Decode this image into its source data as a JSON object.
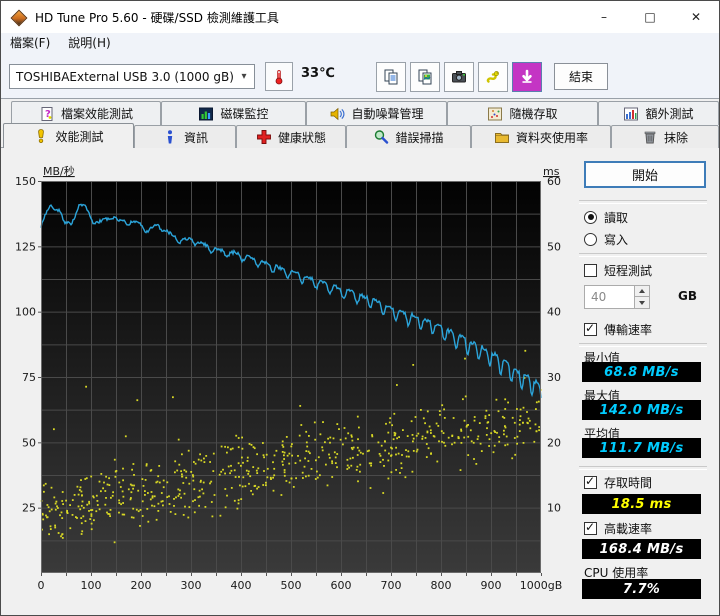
{
  "window": {
    "title": "HD Tune Pro 5.60 - 硬碟/SSD 檢測維護工具",
    "minimize": "–",
    "maximize": "□",
    "close": "✕"
  },
  "menu": {
    "file": "檔案(F)",
    "help": "說明(H)"
  },
  "toolbar": {
    "drive": "TOSHIBAExternal USB 3.0 (1000 gB)",
    "temperature": "33℃",
    "exit": "結束",
    "icons": [
      "thermometer-icon",
      "copy-text-icon",
      "copy-image-icon",
      "camera-icon",
      "gecko-icon",
      "download-icon"
    ]
  },
  "tabs": {
    "back": [
      {
        "label": "檔案效能測試"
      },
      {
        "label": "磁碟監控"
      },
      {
        "label": "自動噪聲管理"
      },
      {
        "label": "隨機存取"
      },
      {
        "label": "額外測試"
      }
    ],
    "front": [
      {
        "label": "效能測試",
        "active": true
      },
      {
        "label": "資訊"
      },
      {
        "label": "健康狀態"
      },
      {
        "label": "錯誤掃描"
      },
      {
        "label": "資料夾使用率"
      },
      {
        "label": "抹除"
      }
    ]
  },
  "panel": {
    "start": "開始",
    "read": "讀取",
    "write": "寫入",
    "selected_mode": "read",
    "short_test": "短程測試",
    "short_checked": false,
    "capacity_value": "40",
    "capacity_unit": "GB",
    "transfer": "傳輸速率",
    "transfer_checked": true,
    "min_label": "最小值",
    "min_value": "68.8 MB/s",
    "max_label": "最大值",
    "max_value": "142.0 MB/s",
    "avg_label": "平均值",
    "avg_value": "111.7 MB/s",
    "access_label": "存取時間",
    "access_checked": true,
    "access_value": "18.5 ms",
    "burst_label": "高載速率",
    "burst_checked": true,
    "burst_value": "168.4 MB/s",
    "cpu_label": "CPU 使用率",
    "cpu_value": "7.7%",
    "value_colors": {
      "speed": "#00ccff",
      "access": "#ffff00",
      "plain": "#ffffff"
    }
  },
  "chart_data": {
    "type": "line+scatter",
    "x_axis": {
      "range": [
        0,
        1000
      ],
      "unit": "gB",
      "grid_step": 50,
      "ticks": [
        "0",
        "100",
        "200",
        "300",
        "400",
        "500",
        "600",
        "700",
        "800",
        "900",
        "1000gB"
      ]
    },
    "left_axis": {
      "label": "MB/秒",
      "range": [
        0,
        150
      ],
      "grid_step": 12.5,
      "ticks": [
        "150",
        "125",
        "100",
        "75",
        "50",
        "25"
      ]
    },
    "right_axis": {
      "label": "ms",
      "range": [
        0,
        60
      ],
      "ticks": [
        "60",
        "50",
        "40",
        "30",
        "20",
        "10"
      ]
    },
    "plot_style": {
      "bg_top": "#020202",
      "bg_bottom": "#3a3a3a",
      "grid_color": "#4a4a4a",
      "border_color": "#6a6a6a"
    },
    "series": [
      {
        "name": "transfer-rate",
        "type": "line",
        "axis": "left",
        "color": "#2ba4da",
        "anchors": [
          [
            0,
            131
          ],
          [
            12,
            136
          ],
          [
            22,
            139
          ],
          [
            35,
            140
          ],
          [
            48,
            136
          ],
          [
            60,
            135
          ],
          [
            75,
            139
          ],
          [
            90,
            138
          ],
          [
            105,
            134
          ],
          [
            120,
            136
          ],
          [
            140,
            137
          ],
          [
            155,
            133
          ],
          [
            175,
            134
          ],
          [
            195,
            135
          ],
          [
            215,
            131
          ],
          [
            235,
            132
          ],
          [
            255,
            130
          ],
          [
            275,
            128
          ],
          [
            300,
            127
          ],
          [
            330,
            125
          ],
          [
            360,
            123
          ],
          [
            390,
            122
          ],
          [
            420,
            120
          ],
          [
            450,
            118
          ],
          [
            480,
            116
          ],
          [
            510,
            114
          ],
          [
            540,
            112
          ],
          [
            570,
            110
          ],
          [
            600,
            108
          ],
          [
            630,
            106
          ],
          [
            660,
            104
          ],
          [
            690,
            101
          ],
          [
            720,
            99
          ],
          [
            750,
            97
          ],
          [
            780,
            95
          ],
          [
            810,
            92
          ],
          [
            840,
            89
          ],
          [
            870,
            86
          ],
          [
            900,
            83
          ],
          [
            930,
            79
          ],
          [
            960,
            75
          ],
          [
            1000,
            70
          ]
        ],
        "osc": {
          "period_start_gb": 38,
          "period_end_gb": 20,
          "amp_start": 0.9,
          "amp_end": 5.6
        }
      },
      {
        "name": "access-time",
        "type": "scatter",
        "axis": "right",
        "color": "#d8d825",
        "count": 650,
        "ms_start": 9.5,
        "ms_end": 24,
        "spread": 7.5,
        "min": 1.2,
        "max": 34,
        "seed": 1337
      }
    ],
    "summary": {
      "min_mbs": 68.8,
      "max_mbs": 142.0,
      "avg_mbs": 111.7,
      "access_ms": 18.5,
      "burst_mbs": 168.4,
      "cpu_pct": 7.7
    }
  }
}
